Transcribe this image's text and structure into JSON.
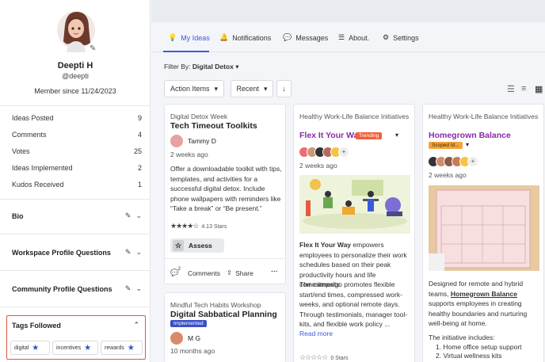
{
  "profile": {
    "name": "Deepti H",
    "handle": "@deepti",
    "member_since": "Member since 11/24/2023"
  },
  "stats": [
    {
      "label": "Ideas Posted",
      "value": "9"
    },
    {
      "label": "Comments",
      "value": "4"
    },
    {
      "label": "Votes",
      "value": "25"
    },
    {
      "label": "Ideas Implemented",
      "value": "2"
    },
    {
      "label": "Kudos Received",
      "value": "1"
    }
  ],
  "sections": {
    "bio": "Bio",
    "workspace": "Workspace Profile Questions",
    "community": "Community Profile Questions",
    "tags": "Tags Followed"
  },
  "tags": [
    "digital",
    "incentives",
    "rewards"
  ],
  "tabs": [
    "My Ideas",
    "Notifications",
    "Messages",
    "About.",
    "Settings"
  ],
  "filter": {
    "label": "Filter By:",
    "value": "Digital Detox"
  },
  "toolbar": {
    "action_items": "Action Items",
    "sort": "Recent"
  },
  "cards": {
    "c1": {
      "category": "Digital Detox Week",
      "title": "Tech Timeout Toolkits",
      "author": "Tammy D",
      "ago": "2 weeks ago",
      "body": "Offer a downloadable toolkit with tips, templates, and activities for a successful digital detox. Include phone wallpapers with reminders like “Take a break” or “Be present.”",
      "rating": "4.13 Stars",
      "assess": "Assess",
      "comments": "Comments",
      "share": "Share",
      "comment_count": "2"
    },
    "c2": {
      "category": "Mindful Tech Habits Workshop",
      "title": "Digital Sabbatical Planning",
      "status": "Implemented",
      "author": "M G",
      "ago": "10 months ago"
    },
    "c3": {
      "category": "Healthy Work-Life Balance Initiatives",
      "title": "Flex It Your Way",
      "status": "Trending",
      "ago": "2 weeks ago",
      "body_bold": "Flex It Your Way",
      "body1": " empowers employees to personalize their work schedules based on their peak productivity hours and life commitments.",
      "body2": "The campaign promotes flexible start/end times, compressed work-weeks, and optional remote days. Through testimonials, manager tool-kits, and flexible work policy ...",
      "read_more": "Read more",
      "rating": "0 Stars"
    },
    "c4": {
      "category": "Healthy Work-Life Balance Initiatives",
      "title": "Homegrown Balance",
      "status": "Scoped Id...",
      "ago": "2 weeks ago",
      "body1": "Designed for remote and hybrid teams, ",
      "body_bold": "Homegrown Balance",
      "body2": " supports employees in creating healthy boundaries and nurturing well-being at home.",
      "includes": "The initiative includes:",
      "list": [
        "1. Home office setup support",
        "2. Virtual wellness kits"
      ]
    }
  },
  "colors": {
    "accent": "#3a5bd9",
    "purple_title": "#8a2aa8",
    "trending": "#f0603a",
    "scoped": "#f3a43b",
    "highlight": "#e0553f"
  }
}
